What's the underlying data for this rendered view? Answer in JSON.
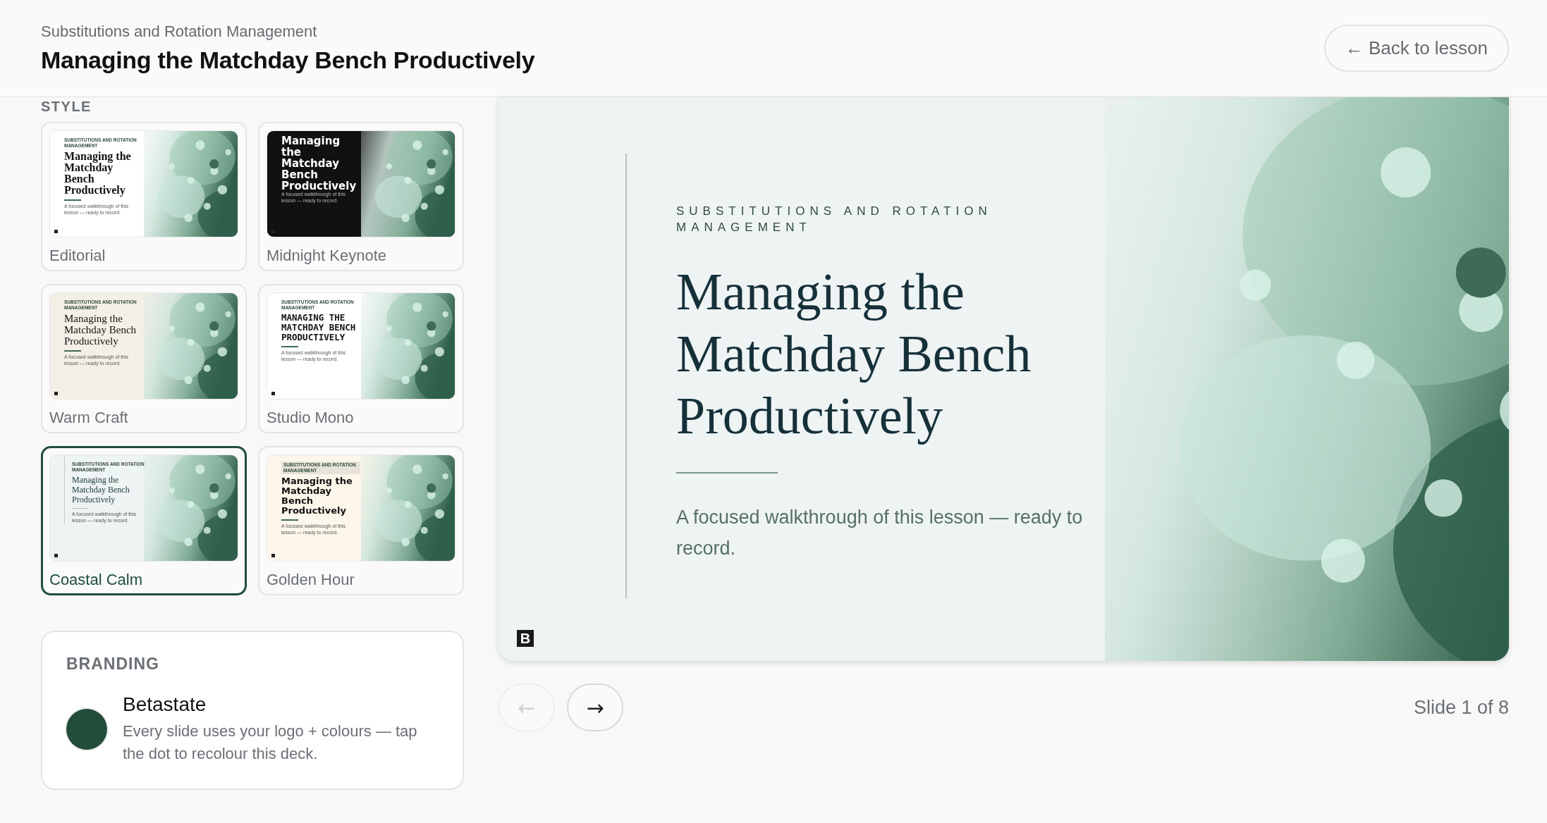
{
  "header": {
    "course": "Substitutions and Rotation Management",
    "title": "Managing the Matchday Bench Productively",
    "back_button": "← Back to lesson"
  },
  "style_label": "STYLE",
  "styles": [
    {
      "name": "Editorial",
      "kind": "editorial",
      "selected": false,
      "eyebrow": "SUBSTITUTIONS AND ROTATION MANAGEMENT",
      "title": "Managing the Matchday Bench Productively",
      "subtitle": "A focused walkthrough of this lesson — ready to record."
    },
    {
      "name": "Midnight Keynote",
      "kind": "midnight",
      "selected": false,
      "title": "Managing the Matchday Bench Productively",
      "subtitle": "A focused walkthrough of this lesson — ready to record."
    },
    {
      "name": "Warm Craft",
      "kind": "warm",
      "selected": false,
      "eyebrow": "SUBSTITUTIONS AND ROTATION MANAGEMENT",
      "title": "Managing the Matchday Bench Productively",
      "subtitle": "A focused walkthrough of this lesson — ready to record."
    },
    {
      "name": "Studio Mono",
      "kind": "mono",
      "selected": false,
      "eyebrow": "SUBSTITUTIONS AND ROTATION MANAGEMENT",
      "title": "MANAGING THE MATCHDAY BENCH PRODUCTIVELY",
      "subtitle": "A focused walkthrough of this lesson — ready to record."
    },
    {
      "name": "Coastal Calm",
      "kind": "coastal",
      "selected": true,
      "eyebrow": "SUBSTITUTIONS AND ROTATION MANAGEMENT",
      "title": "Managing the Matchday Bench Productively",
      "subtitle": "A focused walkthrough of this lesson — ready to record."
    },
    {
      "name": "Golden Hour",
      "kind": "golden",
      "selected": false,
      "eyebrow": "SUBSTITUTIONS AND ROTATION MANAGEMENT",
      "title": "Managing the Matchday Bench Productively",
      "subtitle": "A focused walkthrough of this lesson — ready to record."
    }
  ],
  "branding": {
    "heading": "BRANDING",
    "name": "Betastate",
    "description": "Every slide uses your logo + colours — tap the dot to recolour this deck.",
    "color": "#234c3a"
  },
  "slide": {
    "eyebrow": "SUBSTITUTIONS AND ROTATION MANAGEMENT",
    "title": "Managing the Matchday Bench Productively",
    "subtitle": "A focused walkthrough of this lesson — ready to record.",
    "logo": "B"
  },
  "nav": [
    {
      "label": "←",
      "disabled": true
    },
    {
      "label": "→",
      "disabled": false
    }
  ],
  "slide_counter": "Slide 1 of 8"
}
